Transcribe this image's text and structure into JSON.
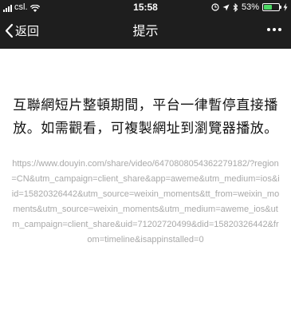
{
  "status_bar": {
    "carrier": "csl.",
    "time": "15:58",
    "battery_percent": "53%",
    "battery_level": 0.53,
    "battery_color": "#4cd964"
  },
  "nav": {
    "back_label": "返回",
    "title": "提示",
    "more_icon": "ellipsis-icon"
  },
  "content": {
    "message": "互聯網短片整頓期間，平台一律暫停直接播放。如需觀看，可複製網址到瀏覽器播放。",
    "url": "https://www.douyin.com/share/video/6470808054362279182/?region=CN&utm_campaign=client_share&app=aweme&utm_medium=ios&iid=15820326442&utm_source=weixin_moments&tt_from=weixin_moments&utm_source=weixin_moments&utm_medium=aweme_ios&utm_campaign=client_share&uid=71202720499&did=15820326442&from=timeline&isappinstalled=0"
  },
  "colors": {
    "header_bg": "#1e1e1e",
    "message_text": "#111111",
    "url_text": "#a9a9a9"
  }
}
